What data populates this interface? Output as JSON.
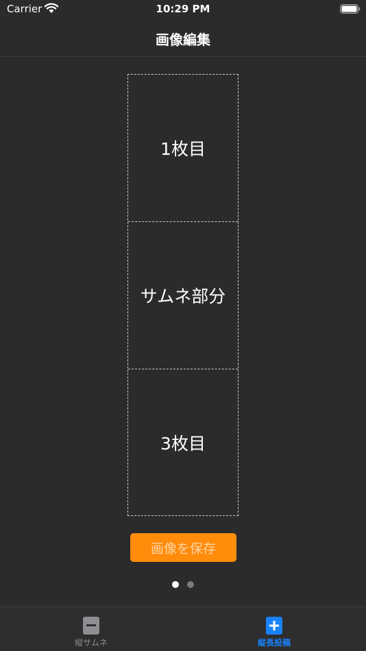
{
  "status": {
    "carrier": "Carrier",
    "time": "10:29 PM"
  },
  "nav": {
    "title": "画像編集"
  },
  "panels": [
    {
      "label": "1枚目"
    },
    {
      "label": "サムネ部分"
    },
    {
      "label": "3枚目"
    }
  ],
  "save_button": {
    "label": "画像を保存"
  },
  "pager": {
    "page_count": 2,
    "current_page": 1
  },
  "tab_bar": {
    "tabs": [
      {
        "label": "縦サムネ",
        "icon": "minus-square-icon",
        "selected": false
      },
      {
        "label": "縦長投稿",
        "icon": "plus-square-icon",
        "selected": true
      }
    ]
  },
  "colors": {
    "background": "#2b2b2c",
    "accent_orange": "#ff8c0a",
    "accent_blue": "#1a82fb",
    "inactive_gray": "#8e8e93"
  }
}
